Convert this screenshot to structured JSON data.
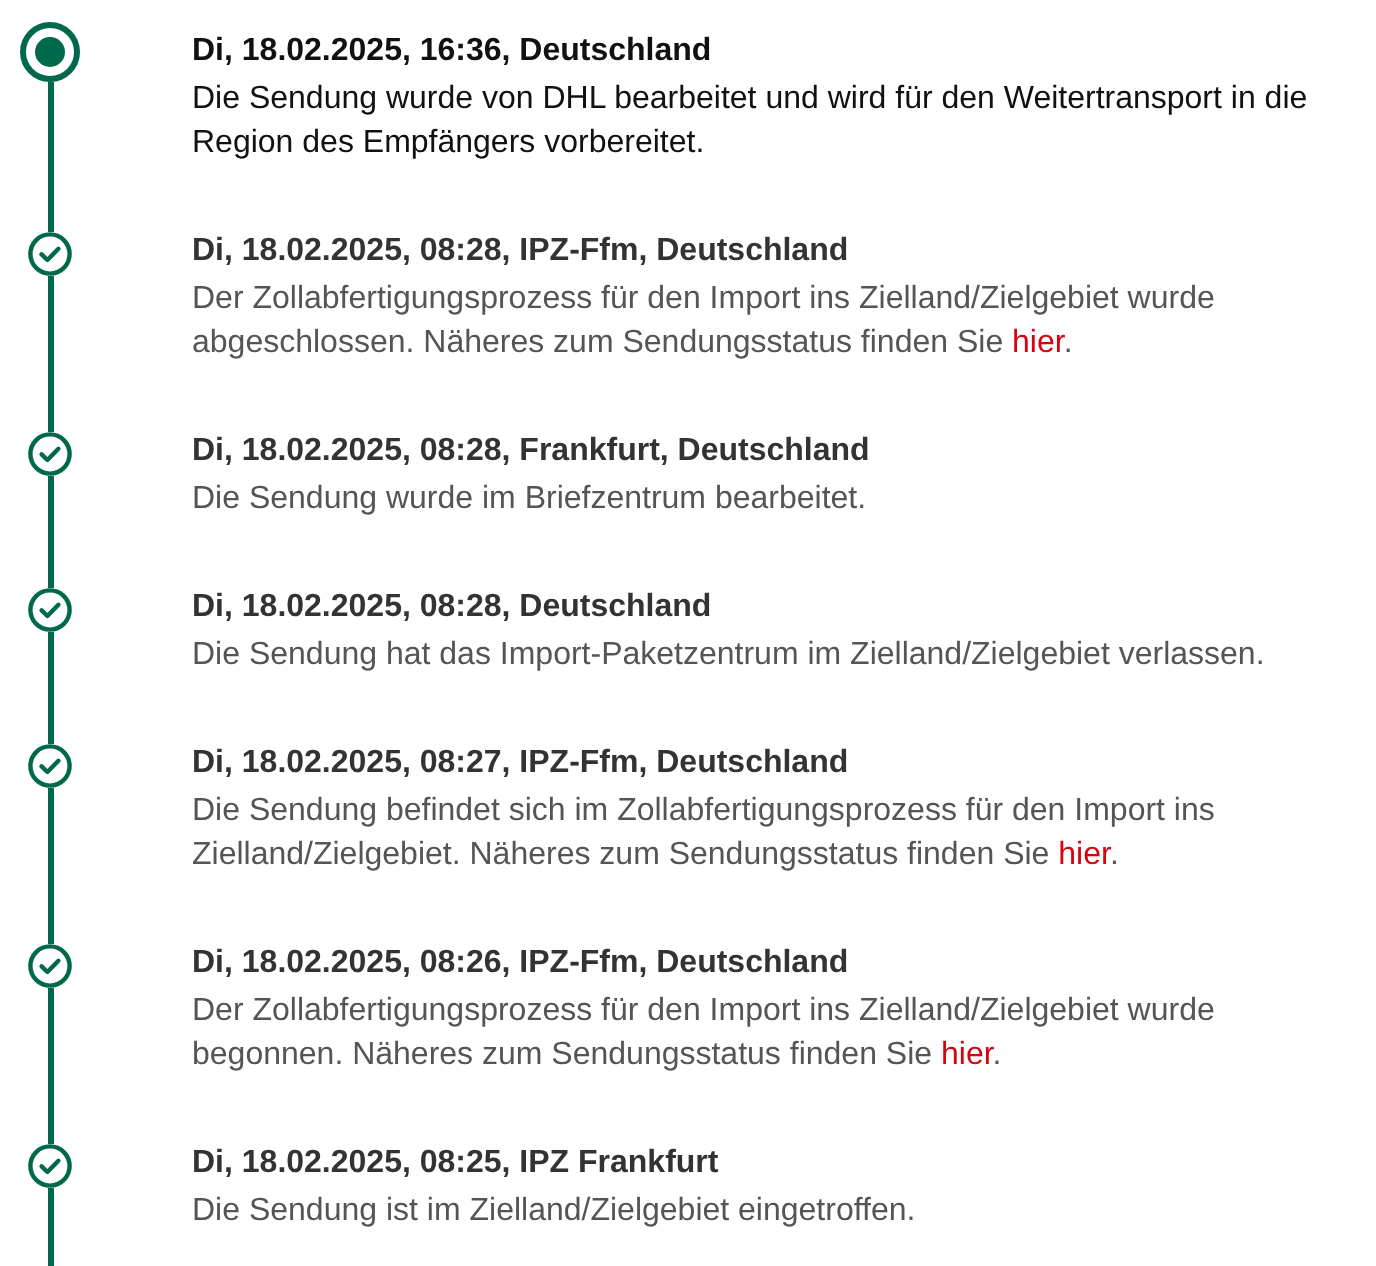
{
  "events": [
    {
      "current": true,
      "heading": "Di, 18.02.2025, 16:36, Deutschland",
      "description": "Die Sendung wurde von DHL bearbeitet und wird für den Weitertransport in die Region des Empfängers vorbereitet."
    },
    {
      "current": false,
      "heading": "Di, 18.02.2025, 08:28, IPZ-Ffm, Deutschland",
      "description": "Der Zollabfertigungsprozess für den Import ins Zielland/Zielgebiet wurde abgeschlossen. Näheres zum Sendungsstatus finden Sie ",
      "link": "hier",
      "suffix": "."
    },
    {
      "current": false,
      "heading": "Di, 18.02.2025, 08:28, Frankfurt, Deutschland",
      "description": "Die Sendung wurde im Briefzentrum bearbeitet."
    },
    {
      "current": false,
      "heading": "Di, 18.02.2025, 08:28, Deutschland",
      "description": "Die Sendung hat das Import-Paketzentrum im Zielland/Zielgebiet verlassen."
    },
    {
      "current": false,
      "heading": "Di, 18.02.2025, 08:27, IPZ-Ffm, Deutschland",
      "description": "Die Sendung befindet sich im Zollabfertigungsprozess für den Import ins Zielland/Zielgebiet. Näheres zum Sendungsstatus finden Sie ",
      "link": "hier",
      "suffix": "."
    },
    {
      "current": false,
      "heading": "Di, 18.02.2025, 08:26, IPZ-Ffm, Deutschland",
      "description": "Der Zollabfertigungsprozess für den Import ins Zielland/Zielgebiet wurde begonnen. Näheres zum Sendungsstatus finden Sie ",
      "link": "hier",
      "suffix": "."
    },
    {
      "current": false,
      "heading": "Di, 18.02.2025, 08:25, IPZ Frankfurt",
      "description": "Die Sendung ist im Zielland/Zielgebiet eingetroffen."
    }
  ]
}
